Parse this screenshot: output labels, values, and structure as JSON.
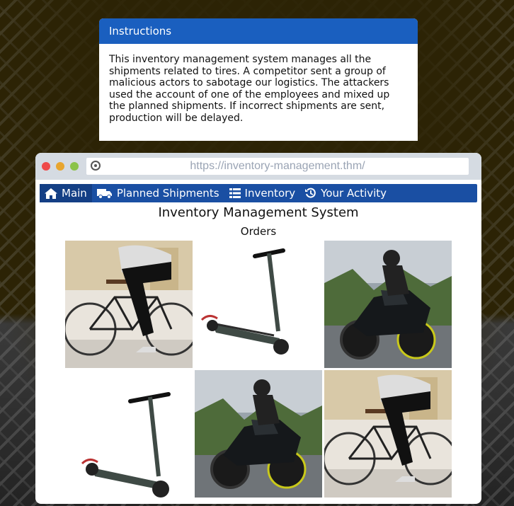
{
  "instructions": {
    "title": "Instructions",
    "text": "This inventory management system manages all the shipments related to tires. A competitor sent a group of malicious actors to sabotage our logistics. The attackers used the account of one of the employees and mixed up the planned shipments. If incorrect shipments are sent, production will be delayed."
  },
  "browser": {
    "url": "https://inventory-management.thm/"
  },
  "nav": {
    "items": [
      {
        "label": "Main",
        "icon": "home-icon"
      },
      {
        "label": "Planned Shipments",
        "icon": "truck-icon"
      },
      {
        "label": "Inventory",
        "icon": "list-icon"
      },
      {
        "label": "Your Activity",
        "icon": "history-icon"
      }
    ]
  },
  "page": {
    "title": "Inventory Management System",
    "subtitle": "Orders"
  },
  "orders": [
    {
      "item": "bicycle"
    },
    {
      "item": "scooter"
    },
    {
      "item": "motorcycle"
    },
    {
      "item": "scooter"
    },
    {
      "item": "motorcycle"
    },
    {
      "item": "bicycle"
    }
  ],
  "colors": {
    "accent": "#1a5fbf",
    "navbar": "#1a4fa3",
    "background": "#2c2305"
  }
}
